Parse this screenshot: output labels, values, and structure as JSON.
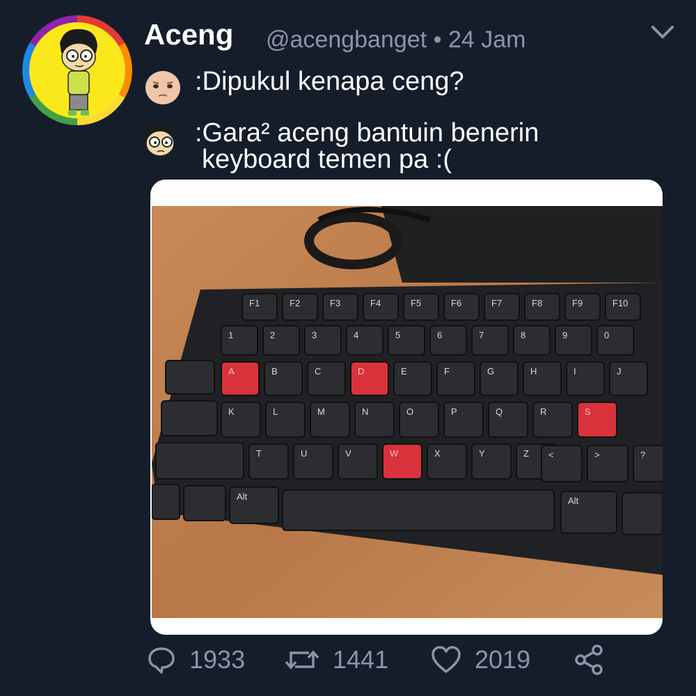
{
  "tweet": {
    "display_name": "Aceng",
    "handle_time": "@acengbanget • 24 Jam",
    "line1": ":Dipukul kenapa ceng?",
    "line2a": ":Gara² aceng bantuin benerin",
    "line2b": "keyboard temen pa :("
  },
  "actions": {
    "reply_count": "1933",
    "retweet_count": "1441",
    "like_count": "2019"
  },
  "keyboard": {
    "fkeys": [
      "F1",
      "F2",
      "F3",
      "F4",
      "F5",
      "F6",
      "F7",
      "F8",
      "F9",
      "F10"
    ],
    "num_row": [
      "1",
      "2",
      "3",
      "4",
      "5",
      "6",
      "7",
      "8",
      "9",
      "0"
    ],
    "row2": [
      "A",
      "B",
      "C",
      "D",
      "E",
      "F",
      "G",
      "H",
      "I",
      "J"
    ],
    "row3": [
      "K",
      "L",
      "M",
      "N",
      "O",
      "P",
      "Q",
      "R",
      "S"
    ],
    "row4": [
      "T",
      "U",
      "V",
      "W",
      "X",
      "Y",
      "Z"
    ],
    "alt_left": "Alt",
    "alt_right": "Alt"
  },
  "colors": {
    "background": "#151d2b",
    "muted": "#8a96a8",
    "red_key": "#d9323b"
  },
  "icons": [
    "chevron-down-icon",
    "reply-icon",
    "retweet-icon",
    "like-icon",
    "share-icon"
  ]
}
